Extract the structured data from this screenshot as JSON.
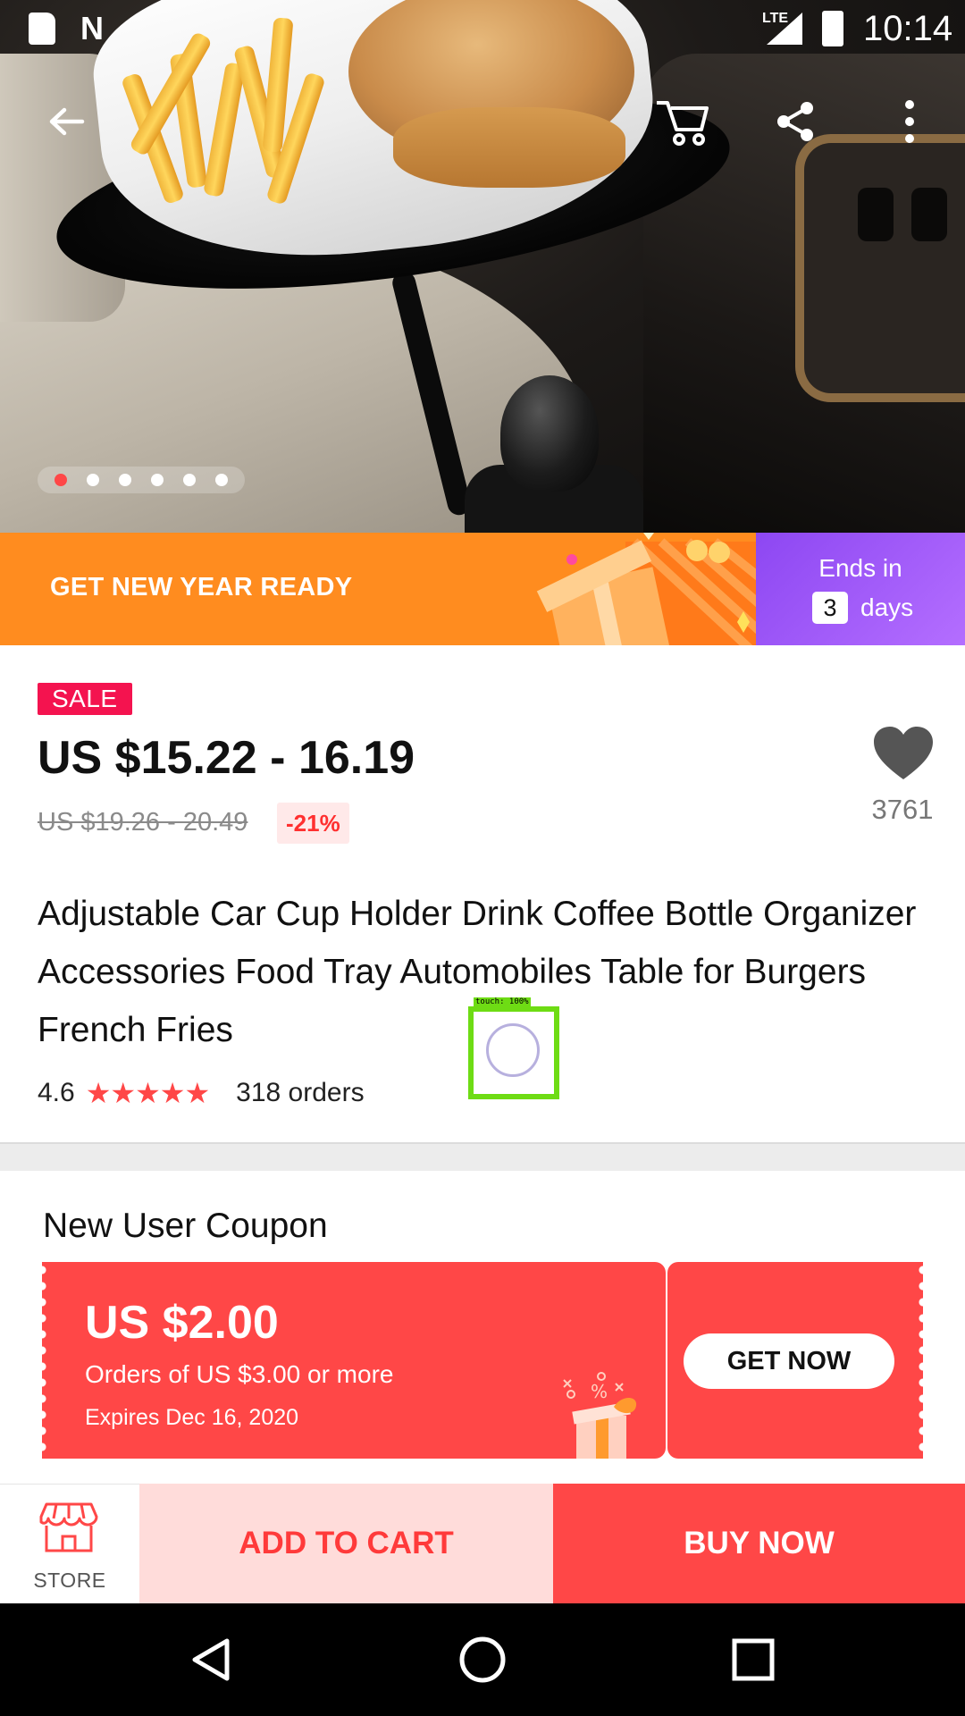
{
  "status_bar": {
    "time": "10:14",
    "network": "LTE",
    "icons": [
      "sd-card-icon",
      "n-notification-icon",
      "signal-icon",
      "battery-charging-icon"
    ]
  },
  "app_bar": {
    "icons": [
      "back-arrow-icon",
      "cart-icon",
      "share-icon",
      "more-vert-icon"
    ]
  },
  "gallery": {
    "page_count": 6,
    "active_page": 1
  },
  "promo": {
    "text": "GET NEW YEAR READY",
    "ends_label": "Ends in",
    "countdown_value": "3",
    "countdown_unit": "days",
    "colors": {
      "left": "#ff8c1f",
      "right": "#a35cf8"
    }
  },
  "product": {
    "badge": "SALE",
    "price": "US $15.22 - 16.19",
    "original_price": "US $19.26 - 20.49",
    "discount": "-21%",
    "wishlist_count": "3761",
    "title": "Adjustable Car Cup Holder Drink Coffee Bottle Organizer Accessories Food Tray Automobiles Table for Burgers French Fries",
    "rating": "4.6",
    "stars": "★★★★★",
    "orders": "318 orders"
  },
  "touch_overlay": {
    "label": "touch: 100%"
  },
  "coupon": {
    "section_title": "New User Coupon",
    "amount": "US $2.00",
    "condition": "Orders of US $3.00 or more",
    "expires": "Expires Dec 16, 2020",
    "button": "GET NOW",
    "color": "#ff4747"
  },
  "action_bar": {
    "store_label": "STORE",
    "add_to_cart": "ADD TO CART",
    "buy_now": "BUY NOW"
  },
  "nav_bar": {
    "icons": [
      "nav-back-icon",
      "nav-home-icon",
      "nav-recents-icon"
    ]
  }
}
